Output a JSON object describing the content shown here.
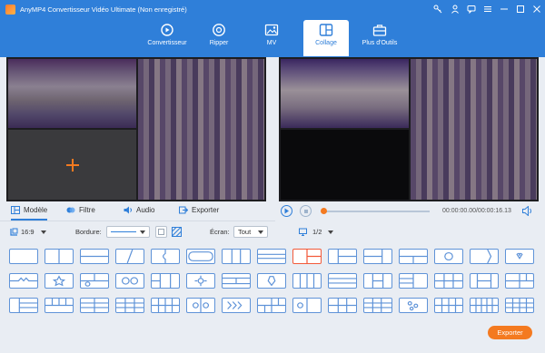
{
  "window": {
    "title": "AnyMP4 Convertisseur Vidéo Ultimate (Non enregistré)"
  },
  "nav": [
    {
      "label": "Convertisseur",
      "icon": "convert-icon"
    },
    {
      "label": "Ripper",
      "icon": "disc-icon"
    },
    {
      "label": "MV",
      "icon": "image-icon"
    },
    {
      "label": "Collage",
      "icon": "collage-icon",
      "active": true
    },
    {
      "label": "Plus d'Outils",
      "icon": "toolbox-icon"
    }
  ],
  "tabs": {
    "modele": "Modèle",
    "filtre": "Filtre",
    "audio": "Audio",
    "exporter": "Exporter"
  },
  "player": {
    "time": "00:00:00.00/00:00:16.13",
    "progress": 0.0
  },
  "options": {
    "ratio": "16:9",
    "bordure_label": "Bordure:",
    "ecran_label": "Écran:",
    "ecran_value": "Tout",
    "page": "1/2"
  },
  "templates": {
    "rows": 3,
    "cols": 15,
    "selected_index": 8
  },
  "export_button": "Exporter",
  "colors": {
    "brand": "#2f7fd9",
    "accent": "#f47a20",
    "selected": "#f25a3a"
  }
}
